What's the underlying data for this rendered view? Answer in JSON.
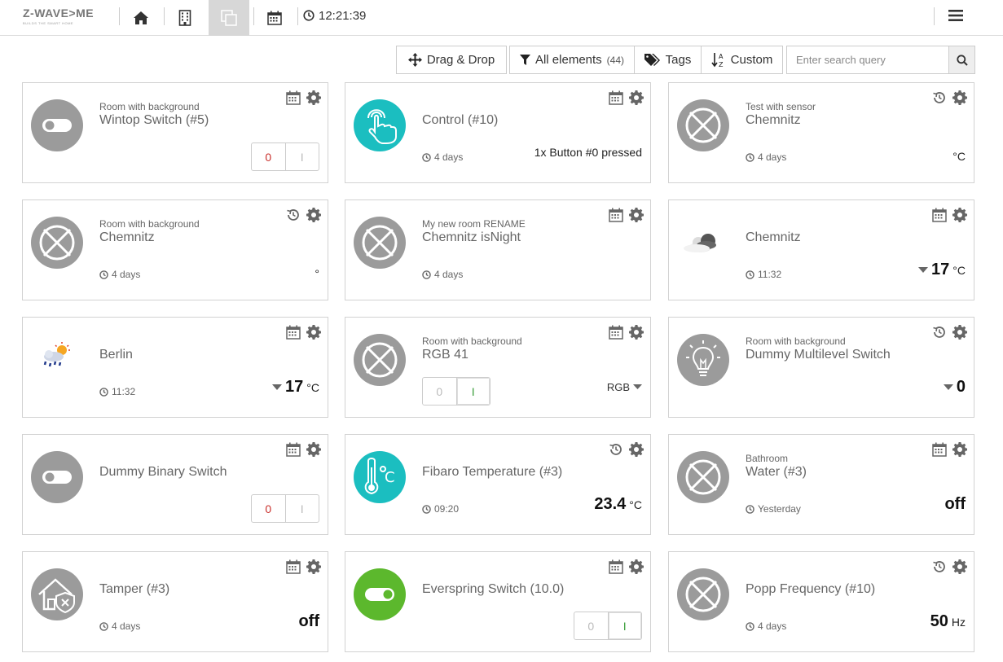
{
  "header": {
    "logo": "Z-WAVE>ME",
    "logo_tagline": "BUILDS THE SMART HOME",
    "clock": "12:21:39"
  },
  "toolbar": {
    "drag_drop_label": "Drag & Drop",
    "all_elements_label": "All elements",
    "all_elements_count": "(44)",
    "tags_label": "Tags",
    "sort_label": "Custom",
    "search_placeholder": "Enter search query"
  },
  "cards": [
    {
      "room": "Room with background",
      "title": "Wintop Switch (#5)",
      "time": "",
      "icon": "toggle-icon",
      "action": "calendar",
      "switch": {
        "off": "0",
        "on": "I",
        "state": "off"
      }
    },
    {
      "room": "",
      "title": "Control (#10)",
      "time": "4 days",
      "icon": "hand-tap-icon",
      "action": "calendar",
      "level": "1x Button #0 pressed"
    },
    {
      "room": "Test with sensor",
      "title": "Chemnitz",
      "time": "4 days",
      "icon": "disabled-circle-icon",
      "action": "history",
      "unit": "°C"
    },
    {
      "room": "Room with background",
      "title": "Chemnitz",
      "time": "4 days",
      "icon": "disabled-circle-icon",
      "action": "history",
      "unit": "°"
    },
    {
      "room": "My new room RENAME",
      "title": "Chemnitz isNight",
      "time": "4 days",
      "icon": "disabled-circle-icon",
      "action": "calendar"
    },
    {
      "room": "",
      "title": "Chemnitz",
      "time": "11:32",
      "icon": "cloudy-icon",
      "action": "calendar",
      "value": "17",
      "unit": "°C"
    },
    {
      "room": "",
      "title": "Berlin",
      "time": "11:32",
      "icon": "rain-sun-icon",
      "action": "calendar",
      "value": "17",
      "unit": "°C"
    },
    {
      "room": "Room with background",
      "title": "RGB 41",
      "time": "",
      "icon": "disabled-circle-icon",
      "action": "calendar",
      "switch": {
        "off": "0",
        "on": "I",
        "state": "on"
      },
      "rgb": "RGB"
    },
    {
      "room": "Room with background",
      "title": "Dummy Multilevel Switch",
      "time": "",
      "icon": "bulb-icon",
      "action": "history",
      "value": "0"
    },
    {
      "room": "",
      "title": "Dummy Binary Switch",
      "time": "",
      "icon": "toggle-icon",
      "action": "calendar",
      "switch": {
        "off": "0",
        "on": "I",
        "state": "off"
      }
    },
    {
      "room": "",
      "title": "Fibaro Temperature (#3)",
      "time": "09:20",
      "icon": "thermometer-icon",
      "action": "history",
      "value": "23.4",
      "unit": "°C"
    },
    {
      "room": "Bathroom",
      "title": "Water (#3)",
      "time": "Yesterday",
      "icon": "disabled-circle-icon",
      "action": "calendar",
      "value": "off"
    },
    {
      "room": "",
      "title": "Tamper (#3)",
      "time": "4 days",
      "icon": "house-shield-icon",
      "action": "calendar",
      "value": "off"
    },
    {
      "room": "",
      "title": "Everspring Switch (10.0)",
      "time": "",
      "icon": "toggle-on-icon",
      "action": "calendar",
      "switch": {
        "off": "0",
        "on": "I",
        "state": "on"
      }
    },
    {
      "room": "",
      "title": "Popp Frequency (#10)",
      "time": "4 days",
      "icon": "disabled-circle-icon",
      "action": "history",
      "value": "50",
      "unit": "Hz"
    }
  ],
  "colors": {
    "icon_gray": "#9b9b9b",
    "teal": "#1bbec0",
    "green": "#5cb82d",
    "off_red": "#c9302c",
    "on_green": "#3c9e3c"
  }
}
